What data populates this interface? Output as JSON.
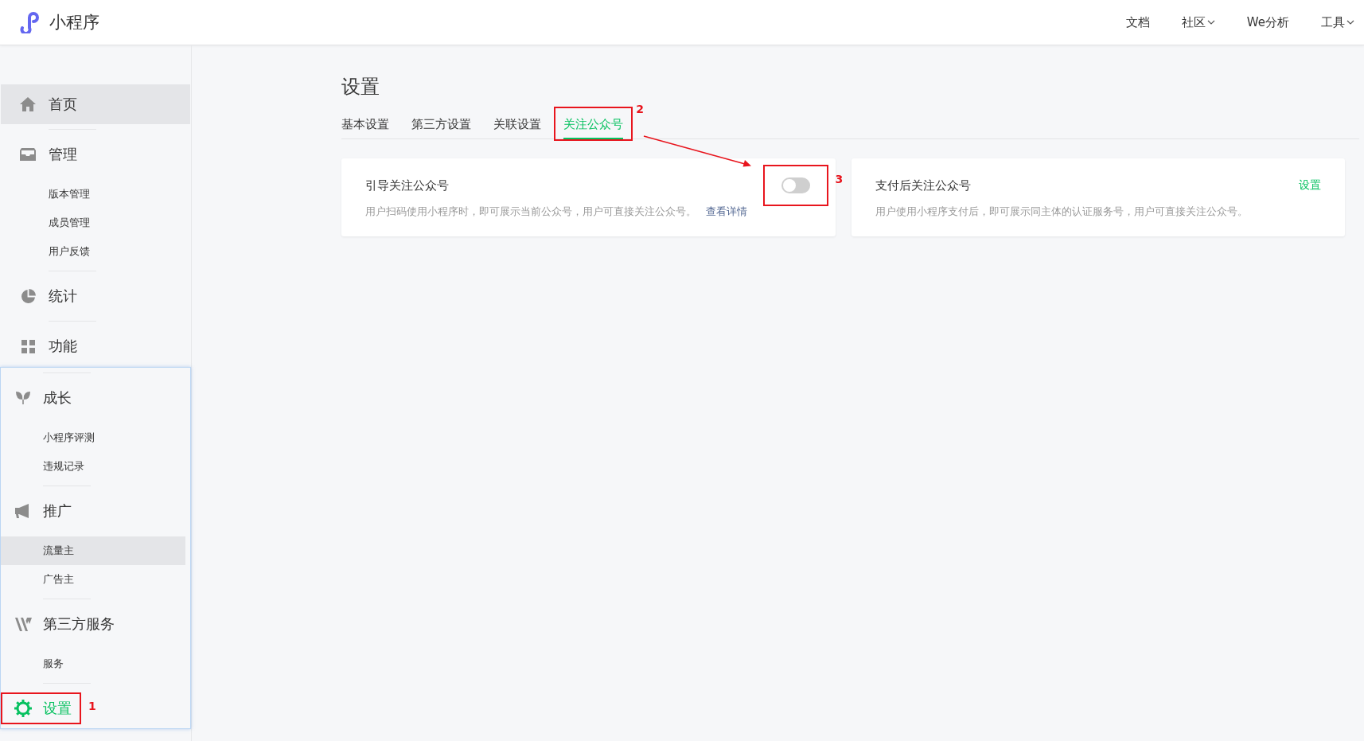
{
  "header": {
    "logo_text": "小程序",
    "nav": [
      {
        "label": "文档",
        "dropdown": false
      },
      {
        "label": "社区",
        "dropdown": true
      },
      {
        "label": "We分析",
        "dropdown": false
      },
      {
        "label": "工具",
        "dropdown": true
      }
    ]
  },
  "sidebar": {
    "panels": [
      {
        "framed": false,
        "sections": [
          {
            "kind": "home",
            "label": "首页",
            "selected": false,
            "highlighted": true
          },
          {
            "kind": "manage",
            "label": "管理",
            "selected": false,
            "highlighted": false,
            "children": [
              {
                "label": "版本管理",
                "selected": false
              },
              {
                "label": "成员管理",
                "selected": false
              },
              {
                "label": "用户反馈",
                "selected": false
              }
            ]
          },
          {
            "kind": "stats",
            "label": "统计",
            "selected": false,
            "highlighted": false
          },
          {
            "kind": "features",
            "label": "功能",
            "selected": false,
            "highlighted": false
          }
        ]
      },
      {
        "framed": true,
        "sections": [
          {
            "kind": "growth",
            "label": "成长",
            "selected": false,
            "highlighted": false,
            "children": [
              {
                "label": "小程序评测",
                "selected": false
              },
              {
                "label": "违规记录",
                "selected": false
              }
            ]
          },
          {
            "kind": "promotion",
            "label": "推广",
            "selected": false,
            "highlighted": false,
            "children": [
              {
                "label": "流量主",
                "selected": true
              },
              {
                "label": "广告主",
                "selected": false
              }
            ]
          },
          {
            "kind": "services",
            "label": "第三方服务",
            "selected": false,
            "highlighted": false,
            "children": [
              {
                "label": "服务",
                "selected": false
              }
            ]
          },
          {
            "kind": "settings",
            "label": "设置",
            "selected": true,
            "highlighted": false,
            "callout": "1"
          }
        ]
      }
    ]
  },
  "main": {
    "title": "设置",
    "tabs": [
      {
        "label": "基本设置",
        "selected": false
      },
      {
        "label": "第三方设置",
        "selected": false
      },
      {
        "label": "关联设置",
        "selected": false
      },
      {
        "label": "关注公众号",
        "selected": true,
        "callout": "2"
      }
    ],
    "callout_arrow": true,
    "cards": [
      {
        "title": "引导关注公众号",
        "description": "用户扫码使用小程序时，即可展示当前公众号，用户可直接关注公众号。",
        "link": "查看详情",
        "control": {
          "kind": "toggle",
          "on": false,
          "callout": "3"
        }
      },
      {
        "title": "支付后关注公众号",
        "description": "用户使用小程序支付后，即可展示同主体的认证服务号，用户可直接关注公众号。",
        "control": {
          "kind": "link",
          "label": "设置"
        }
      }
    ]
  }
}
